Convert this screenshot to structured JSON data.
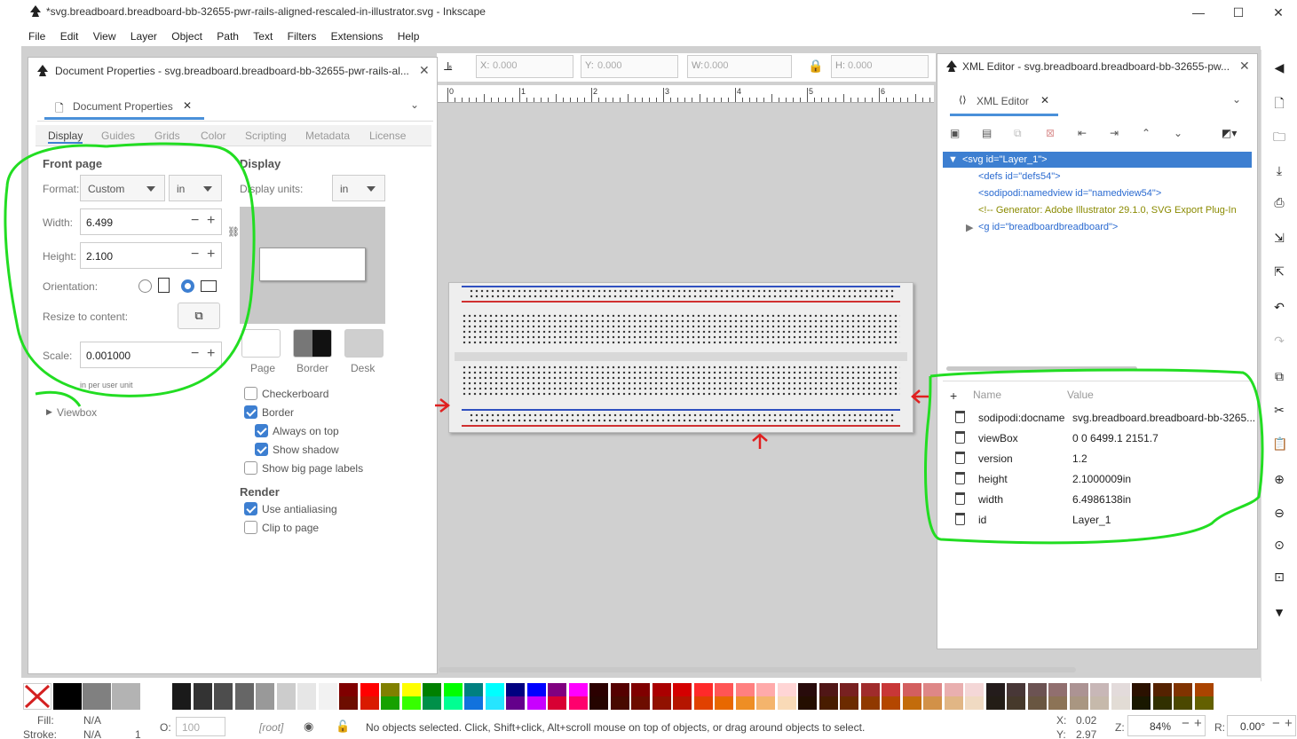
{
  "window": {
    "title": "*svg.breadboard.breadboard-bb-32655-pwr-rails-aligned-rescaled-in-illustrator.svg - Inkscape",
    "minimize": "—",
    "maximize": "☐",
    "close": "✕"
  },
  "menu": [
    "File",
    "Edit",
    "View",
    "Layer",
    "Object",
    "Path",
    "Text",
    "Filters",
    "Extensions",
    "Help"
  ],
  "controls": {
    "x_label": "X:",
    "x_value": "0.000",
    "y_label": "Y:",
    "y_value": "0.000",
    "w_label": "W:",
    "w_value": "0.000",
    "h_label": "H:",
    "h_value": "0.000"
  },
  "ruler": [
    "0",
    "1",
    "2",
    "3",
    "4",
    "5",
    "6"
  ],
  "doc_props": {
    "window_title": "Document Properties - svg.breadboard.breadboard-bb-32655-pwr-rails-al...",
    "tab_label": "Document Properties",
    "subtabs": [
      "Display",
      "Guides",
      "Grids",
      "Color",
      "Scripting",
      "Metadata",
      "License"
    ],
    "front_page": {
      "title": "Front page",
      "format_label": "Format:",
      "format_value": "Custom",
      "format_unit": "in",
      "width_label": "Width:",
      "width_value": "6.499",
      "height_label": "Height:",
      "height_value": "2.100",
      "orientation_label": "Orientation:",
      "resize_label": "Resize to content:",
      "scale_label": "Scale:",
      "scale_value": "0.001000",
      "scale_hint": "in per user unit",
      "viewbox_label": "Viewbox"
    },
    "display": {
      "title": "Display",
      "units_label": "Display units:",
      "units_value": "in",
      "page_label": "Page",
      "border_label": "Border",
      "desk_label": "Desk",
      "checkerboard": "Checkerboard",
      "border": "Border",
      "always_on_top": "Always on top",
      "show_shadow": "Show shadow",
      "big_page_labels": "Show big page labels"
    },
    "render": {
      "title": "Render",
      "antialiasing": "Use antialiasing",
      "clip_to_page": "Clip to page"
    }
  },
  "xml_editor": {
    "window_title": "XML Editor - svg.breadboard.breadboard-bb-32655-pw...",
    "tab_label": "XML Editor",
    "nodes": [
      "<svg id=\"Layer_1\">",
      "<defs id=\"defs54\">",
      "<sodipodi:namedview id=\"namedview54\">",
      "<!-- Generator: Adobe Illustrator 29.1.0, SVG Export Plug-In",
      "<g id=\"breadboardbreadboard\">"
    ],
    "attr_header": {
      "name": "Name",
      "value": "Value"
    },
    "attributes": [
      {
        "name": "sodipodi:docname",
        "value": "svg.breadboard.breadboard-bb-3265..."
      },
      {
        "name": "viewBox",
        "value": "0 0 6499.1 2151.7"
      },
      {
        "name": "version",
        "value": "1.2"
      },
      {
        "name": "height",
        "value": "2.1000009in"
      },
      {
        "name": "width",
        "value": "6.4986138in"
      },
      {
        "name": "id",
        "value": "Layer_1"
      }
    ]
  },
  "status": {
    "fill_label": "Fill:",
    "fill_value": "N/A",
    "stroke_label": "Stroke:",
    "stroke_value": "N/A",
    "stroke_width": "1",
    "opacity_label": "O:",
    "opacity_value": "100",
    "layer": "[root]",
    "message": "No objects selected. Click, Shift+click, Alt+scroll mouse on top of objects, or drag around objects to select.",
    "x_label": "X:",
    "x_value": "0.02",
    "y_label": "Y:",
    "y_value": "2.97",
    "zoom_label": "Z:",
    "zoom_value": "84%",
    "rot_label": "R:",
    "rot_value": "0.00°"
  },
  "palette_colors": [
    "#000000",
    "#808080",
    "#b3b3b3",
    "#ffffff",
    "#1a1a1a",
    "#333333",
    "#4d4d4d",
    "#666666",
    "#999999",
    "#cccccc",
    "#e6e6e6",
    "#f2f2f2",
    "#800000",
    "#ff0000",
    "#808000",
    "#ffff00",
    "#008000",
    "#00ff00",
    "#008080",
    "#00ffff",
    "#000080",
    "#0000ff",
    "#800080",
    "#ff00ff",
    "#2b0000",
    "#550000",
    "#800000",
    "#aa0000",
    "#d40000",
    "#ff2a2a",
    "#ff5555",
    "#ff8080",
    "#ffaaaa",
    "#ffd5d5",
    "#280b0b",
    "#501616",
    "#782121",
    "#a02c2c",
    "#c83737",
    "#d35f5f",
    "#de8787",
    "#e9afaf",
    "#f4d7d7",
    "#241c1c",
    "#483737",
    "#6c5353",
    "#916f6f",
    "#ac9393",
    "#c8b7b7",
    "#e3dbdb",
    "#2b1100",
    "#552200",
    "#803300",
    "#aa4400"
  ],
  "accent": "#3d7fd1",
  "annotation_color": "#22dd22"
}
